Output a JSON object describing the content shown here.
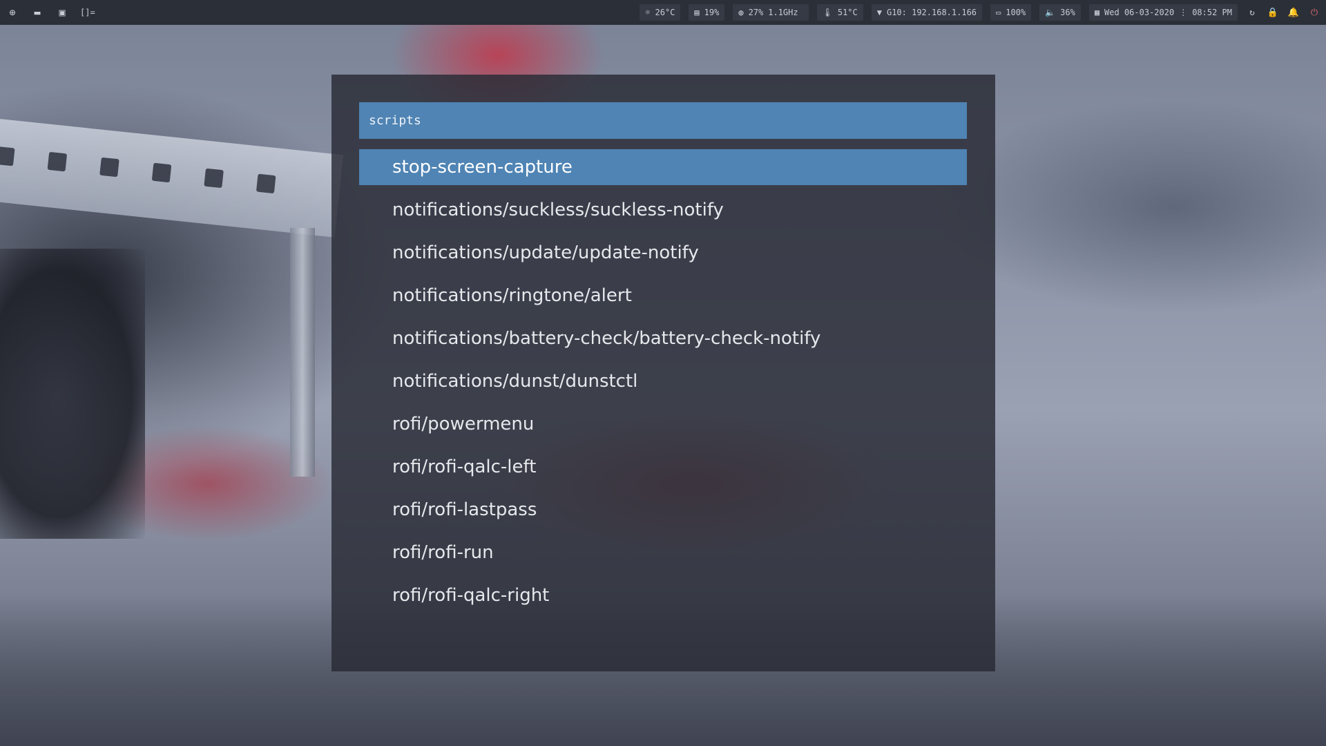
{
  "topbar": {
    "workspaces": [
      {
        "icon": "globe-icon",
        "glyph": "⊕"
      },
      {
        "icon": "folder-icon",
        "glyph": "▬"
      },
      {
        "icon": "chat-icon",
        "glyph": "▣"
      }
    ],
    "layout_symbol": "[]=",
    "modules": {
      "brightness": {
        "icon": "sun-icon",
        "glyph": "☼",
        "value": "26°C"
      },
      "memory": {
        "icon": "memory-icon",
        "glyph": "▤",
        "value": "19%"
      },
      "cpu": {
        "icon": "cpu-icon",
        "glyph": "◍",
        "value": "27%",
        "freq": "1.1GHz"
      },
      "temperature": {
        "icon": "thermometer-icon",
        "glyph": "🌡",
        "value": "51°C"
      },
      "wifi": {
        "icon": "wifi-icon",
        "glyph": "▼",
        "value": "G10: 192.168.1.166"
      },
      "battery": {
        "icon": "battery-icon",
        "glyph": "▭",
        "value": "100%"
      },
      "volume": {
        "icon": "volume-icon",
        "glyph": "🔈",
        "value": "36%"
      },
      "datetime": {
        "icon": "calendar-icon",
        "glyph": "▦",
        "date": "Wed 06-03-2020",
        "time": "08:52 PM",
        "separator": "⋮"
      }
    },
    "tray": [
      {
        "icon": "refresh-icon",
        "glyph": "↻"
      },
      {
        "icon": "lock-icon",
        "glyph": "🔒"
      },
      {
        "icon": "bell-icon",
        "glyph": "🔔"
      },
      {
        "icon": "power-icon",
        "glyph": "⏻"
      }
    ],
    "power_color": "#e06c75"
  },
  "rofi": {
    "prompt": "scripts",
    "accent_color": "#4f84b4",
    "entries": [
      "stop-screen-capture",
      "notifications/suckless/suckless-notify",
      "notifications/update/update-notify",
      "notifications/ringtone/alert",
      "notifications/battery-check/battery-check-notify",
      "notifications/dunst/dunstctl",
      "rofi/powermenu",
      "rofi/rofi-qalc-left",
      "rofi/rofi-lastpass",
      "rofi/rofi-run",
      "rofi/rofi-qalc-right"
    ],
    "selected_index": 0
  }
}
